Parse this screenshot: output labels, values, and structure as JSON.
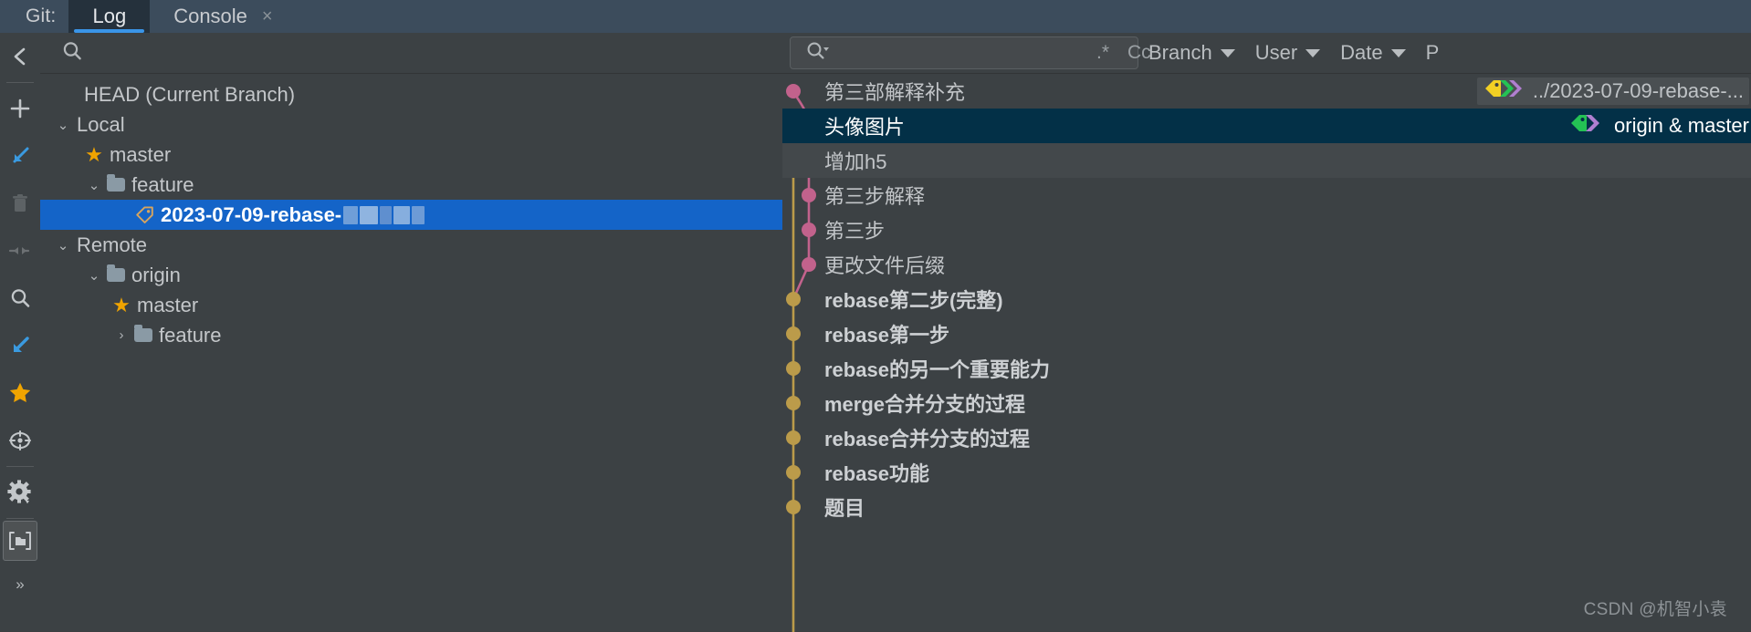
{
  "window": {
    "git_label": "Git:",
    "tabs": [
      {
        "label": "Log",
        "active": true,
        "closable": false
      },
      {
        "label": "Console",
        "active": false,
        "closable": true,
        "close_glyph": "×"
      }
    ]
  },
  "rail": {
    "items": [
      {
        "name": "collapse-panel-icon",
        "glyph": "back-chevron"
      },
      {
        "name": "add-icon",
        "glyph": "plus"
      },
      {
        "name": "checkout-icon",
        "glyph": "arrow-down-left-blue"
      },
      {
        "name": "delete-icon",
        "glyph": "trash"
      },
      {
        "name": "collapse-all-icon",
        "glyph": "collapse-arrows"
      },
      {
        "name": "search-icon",
        "glyph": "magnifier"
      },
      {
        "name": "update-project-icon",
        "glyph": "arrow-down-left-blue-2"
      },
      {
        "name": "favorite-icon",
        "glyph": "star"
      },
      {
        "name": "target-icon",
        "glyph": "crosshair"
      },
      {
        "name": "settings-icon",
        "glyph": "gear"
      },
      {
        "name": "show-branches-icon",
        "glyph": "folder-framed",
        "selected": true
      },
      {
        "name": "more-icon",
        "glyph": "»"
      }
    ]
  },
  "tree": {
    "search_placeholder": "",
    "rows": [
      {
        "label": "HEAD (Current Branch)",
        "indent": 1,
        "twisty": "",
        "icon": "none",
        "selected": false
      },
      {
        "label": "Local",
        "indent": 1,
        "twisty": "⌄",
        "icon": "none",
        "selected": false
      },
      {
        "label": "master",
        "indent": 2,
        "twisty": "",
        "icon": "star",
        "selected": false
      },
      {
        "label": "feature",
        "indent": 2,
        "twisty": "⌄",
        "icon": "folder",
        "selected": false
      },
      {
        "label": "2023-07-09-rebase-",
        "indent": 3,
        "twisty": "",
        "icon": "tag",
        "selected": true,
        "blurred_suffix": true
      },
      {
        "label": "Remote",
        "indent": 1,
        "twisty": "⌄",
        "icon": "none",
        "selected": false
      },
      {
        "label": "origin",
        "indent": 2,
        "twisty": "⌄",
        "icon": "folder",
        "selected": false
      },
      {
        "label": "master",
        "indent": 3,
        "twisty": "",
        "icon": "star",
        "selected": false
      },
      {
        "label": "feature",
        "indent": 3,
        "twisty": "›",
        "icon": "folder",
        "selected": false
      }
    ]
  },
  "log": {
    "search": {
      "value": "",
      "placeholder": "",
      "regex_label": ".*",
      "case_label": "Cc"
    },
    "filters": [
      {
        "label": "Branch"
      },
      {
        "label": "User"
      },
      {
        "label": "Date"
      },
      {
        "label": "P"
      }
    ],
    "commits": [
      {
        "subject": "第三部解释补充",
        "bold": false,
        "highlight": false,
        "refs": {
          "text": "../2023-07-09-rebase-...",
          "icons": [
            "tag-yellow",
            "chevron-green",
            "chevron-purple"
          ],
          "background": true
        }
      },
      {
        "subject": "头像图片",
        "bold": false,
        "highlight": true,
        "refs": {
          "text": "origin & master",
          "icons": [
            "tag-green",
            "chevron-purple"
          ],
          "background": false
        }
      },
      {
        "subject": "增加h5",
        "bold": false,
        "highlight": false,
        "refs": null
      },
      {
        "subject": "第三步解释",
        "bold": false,
        "highlight": false,
        "refs": null
      },
      {
        "subject": "第三步",
        "bold": false,
        "highlight": false,
        "refs": null
      },
      {
        "subject": "更改文件后缀",
        "bold": false,
        "highlight": false,
        "refs": null
      },
      {
        "subject": "rebase第二步(完整)",
        "bold": true,
        "highlight": false,
        "refs": null
      },
      {
        "subject": "rebase第一步",
        "bold": true,
        "highlight": false,
        "refs": null
      },
      {
        "subject": "rebase的另一个重要能力",
        "bold": true,
        "highlight": false,
        "refs": null
      },
      {
        "subject": "merge合并分支的过程",
        "bold": true,
        "highlight": false,
        "refs": null
      },
      {
        "subject": "rebase合并分支的过程",
        "bold": true,
        "highlight": false,
        "refs": null
      },
      {
        "subject": "rebase功能",
        "bold": true,
        "highlight": false,
        "refs": null
      },
      {
        "subject": "题目",
        "bold": true,
        "highlight": false,
        "refs": null
      }
    ]
  },
  "watermark": "CSDN @机智小袁",
  "colors": {
    "accent_blue": "#3a95e8",
    "selection_blue": "#1464c8",
    "highlight_row": "#033047",
    "graph_gold": "#bb9b4a",
    "graph_pink": "#c2628c",
    "tag_yellow": "#f2d024",
    "tag_green": "#24c254",
    "chevron_purple": "#b07fd0",
    "star_orange": "#f0a400",
    "panel_bg": "#3c4144",
    "tabstrip_bg": "#3c4c5c"
  }
}
